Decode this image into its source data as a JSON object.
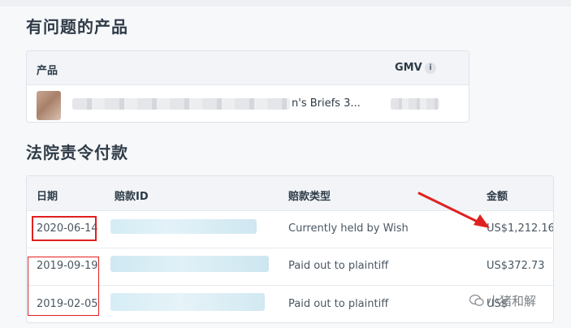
{
  "sections": {
    "problem_products_title": "有问题的产品",
    "court_payments_title": "法院责令付款"
  },
  "products_table": {
    "headers": {
      "product": "产品",
      "gmv": "GMV",
      "gmv_info": "i"
    },
    "rows": [
      {
        "product_name": "n's Briefs 3..."
      }
    ]
  },
  "payments_table": {
    "headers": {
      "date": "日期",
      "payment_id": "赔款ID",
      "payment_type": "赔款类型",
      "amount": "金额"
    },
    "rows": [
      {
        "date": "2020-06-14",
        "type": "Currently held by Wish",
        "amount": "US$1,212.16"
      },
      {
        "date": "2019-09-19",
        "type": "Paid out to plaintiff",
        "amount": "US$372.73"
      },
      {
        "date": "2019-02-05",
        "type": "Paid out to plaintiff",
        "amount": "US$"
      }
    ]
  },
  "watermark": {
    "text": "小猪和解"
  },
  "colors": {
    "annotation_red": "#e02020",
    "blur_cyan": "#cfe9f2"
  }
}
